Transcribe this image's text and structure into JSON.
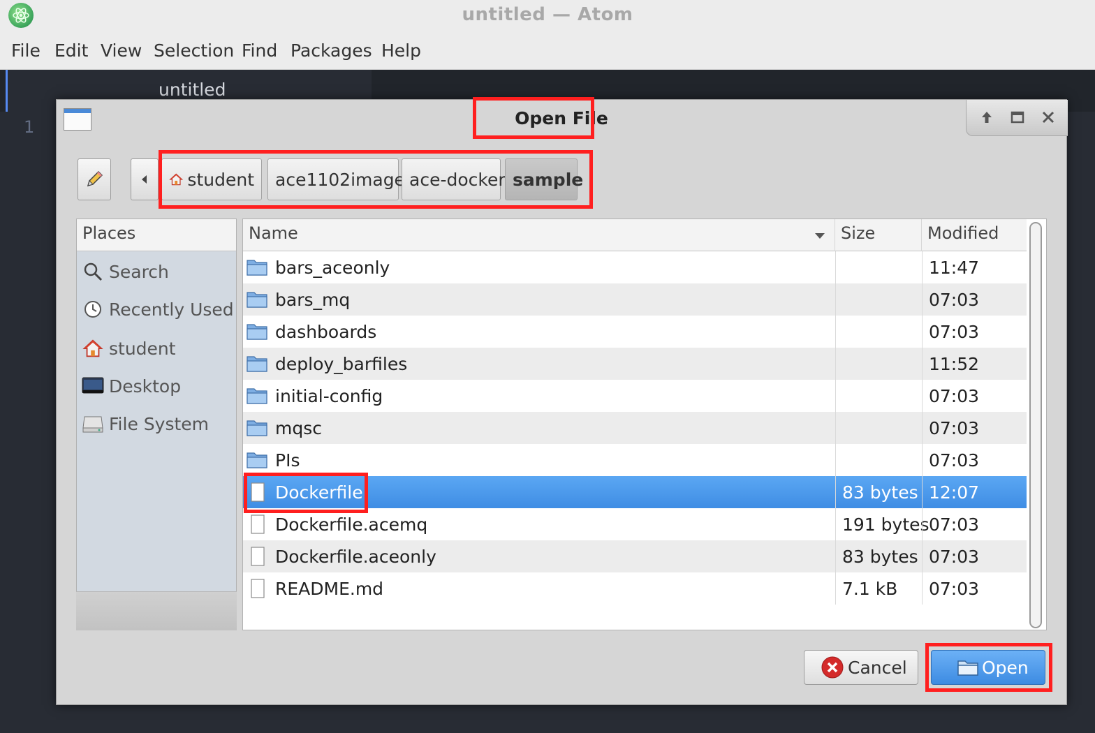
{
  "window": {
    "title": "untitled — Atom"
  },
  "menu": [
    "File",
    "Edit",
    "View",
    "Selection",
    "Find",
    "Packages",
    "Help"
  ],
  "editor": {
    "tab_label": "untitled",
    "line_number": "1"
  },
  "dialog": {
    "title": "Open File",
    "path": [
      "student",
      "ace1102image",
      "ace-docker",
      "sample"
    ],
    "active_path": "sample",
    "places_header": "Places",
    "places": [
      {
        "label": "Search",
        "icon": "search-icon"
      },
      {
        "label": "Recently Used",
        "icon": "clock-icon"
      },
      {
        "label": "student",
        "icon": "home-icon"
      },
      {
        "label": "Desktop",
        "icon": "desktop-icon"
      },
      {
        "label": "File System",
        "icon": "drive-icon"
      }
    ],
    "columns": {
      "name": "Name",
      "size": "Size",
      "modified": "Modified"
    },
    "files": [
      {
        "name": "bars_aceonly",
        "size": "",
        "modified": "11:47",
        "type": "folder"
      },
      {
        "name": "bars_mq",
        "size": "",
        "modified": "07:03",
        "type": "folder"
      },
      {
        "name": "dashboards",
        "size": "",
        "modified": "07:03",
        "type": "folder"
      },
      {
        "name": "deploy_barfiles",
        "size": "",
        "modified": "11:52",
        "type": "folder"
      },
      {
        "name": "initial-config",
        "size": "",
        "modified": "07:03",
        "type": "folder"
      },
      {
        "name": "mqsc",
        "size": "",
        "modified": "07:03",
        "type": "folder"
      },
      {
        "name": "PIs",
        "size": "",
        "modified": "07:03",
        "type": "folder"
      },
      {
        "name": "Dockerfile",
        "size": "83 bytes",
        "modified": "12:07",
        "type": "file",
        "selected": true
      },
      {
        "name": "Dockerfile.acemq",
        "size": "191 bytes",
        "modified": "07:03",
        "type": "file"
      },
      {
        "name": "Dockerfile.aceonly",
        "size": "83 bytes",
        "modified": "07:03",
        "type": "file"
      },
      {
        "name": "README.md",
        "size": "7.1 kB",
        "modified": "07:03",
        "type": "file"
      }
    ],
    "buttons": {
      "cancel": "Cancel",
      "open": "Open"
    }
  },
  "colors": {
    "highlight": "#ff1f1f",
    "selection": "#4a96ea",
    "atom_accent": "#568af2"
  }
}
